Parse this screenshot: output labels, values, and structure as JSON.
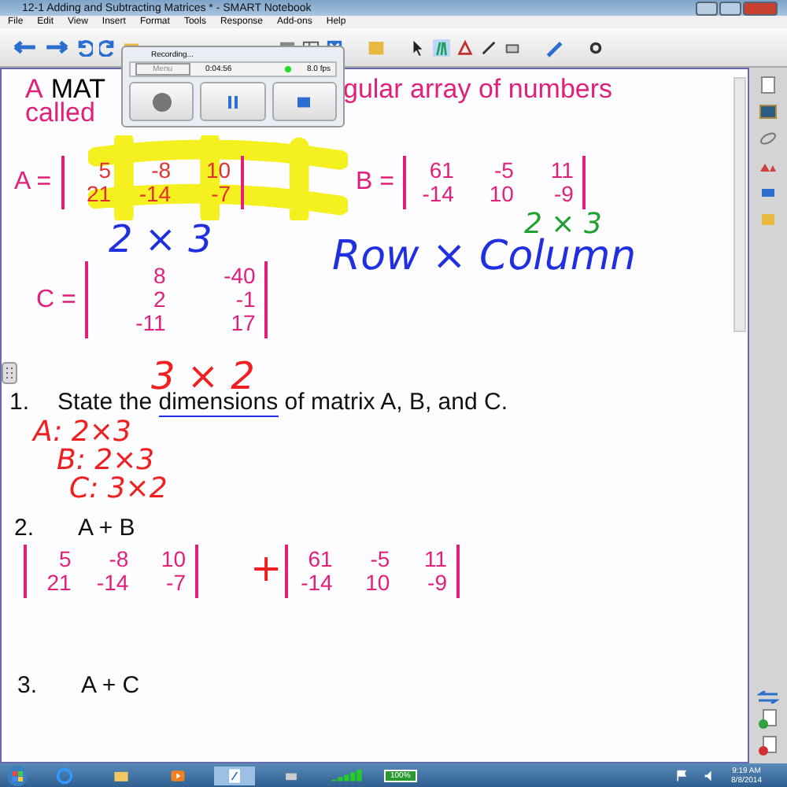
{
  "window": {
    "title": "12-1 Adding and Subtracting Matrices * - SMART Notebook"
  },
  "menu": [
    "File",
    "Edit",
    "View",
    "Insert",
    "Format",
    "Tools",
    "Response",
    "Add-ons",
    "Help"
  ],
  "recorder": {
    "title": "Recording...",
    "menu": "Menu",
    "elapsed": "0:04:56",
    "fps": "8.0 fps"
  },
  "intro": [
    {
      "text": "A",
      "kind": "plain"
    },
    {
      "text": "MAT",
      "kind": "key"
    },
    {
      "text": "gular array of numbers",
      "kind": "plain"
    },
    {
      "text": "called",
      "kind": "plain"
    }
  ],
  "matrices": [
    {
      "label": "A =",
      "rows": [
        [
          "5",
          "-8",
          "10"
        ],
        [
          "21",
          "-14",
          "-7"
        ]
      ],
      "highlighted": true
    },
    {
      "label": "B =",
      "rows": [
        [
          "61",
          "-5",
          "11"
        ],
        [
          "-14",
          "10",
          "-9"
        ]
      ],
      "highlighted": false
    },
    {
      "label": "C =",
      "rows": [
        [
          "8",
          "-40"
        ],
        [
          "2",
          "-1"
        ],
        [
          "-11",
          "17"
        ]
      ],
      "highlighted": false
    }
  ],
  "ink": [
    {
      "text": "2 × 3",
      "color": "#2030e0"
    },
    {
      "text": "2 × 3",
      "color": "#20a030"
    },
    {
      "text": "Row × Column",
      "color": "#2030e0"
    },
    {
      "text": "3 × 2",
      "color": "#f02020"
    },
    {
      "text": "A: 2×3",
      "color": "#f02020"
    },
    {
      "text": "B: 2×3",
      "color": "#f02020"
    },
    {
      "text": "C: 3×2",
      "color": "#f02020"
    },
    {
      "text": "+",
      "color": "#f02020"
    }
  ],
  "questions": [
    {
      "number": "1.",
      "parts": [
        {
          "text": "State the ",
          "underlined": false
        },
        {
          "text": "dimensions",
          "underlined": true
        },
        {
          "text": " of matrix A, B, and C.",
          "underlined": false
        }
      ]
    },
    {
      "number": "2.",
      "parts": [
        {
          "text": "A + B",
          "underlined": false
        }
      ]
    },
    {
      "number": "3.",
      "parts": [
        {
          "text": "A + C",
          "underlined": false
        }
      ]
    }
  ],
  "sum": [
    {
      "rows": [
        [
          "5",
          "-8",
          "10"
        ],
        [
          "21",
          "-14",
          "-7"
        ]
      ]
    },
    {
      "rows": [
        [
          "61",
          "-5",
          "11"
        ],
        [
          "-14",
          "10",
          "-9"
        ]
      ]
    }
  ],
  "taskbar": {
    "battery": "100%",
    "time": "9:19 AM",
    "date": "8/8/2014"
  }
}
